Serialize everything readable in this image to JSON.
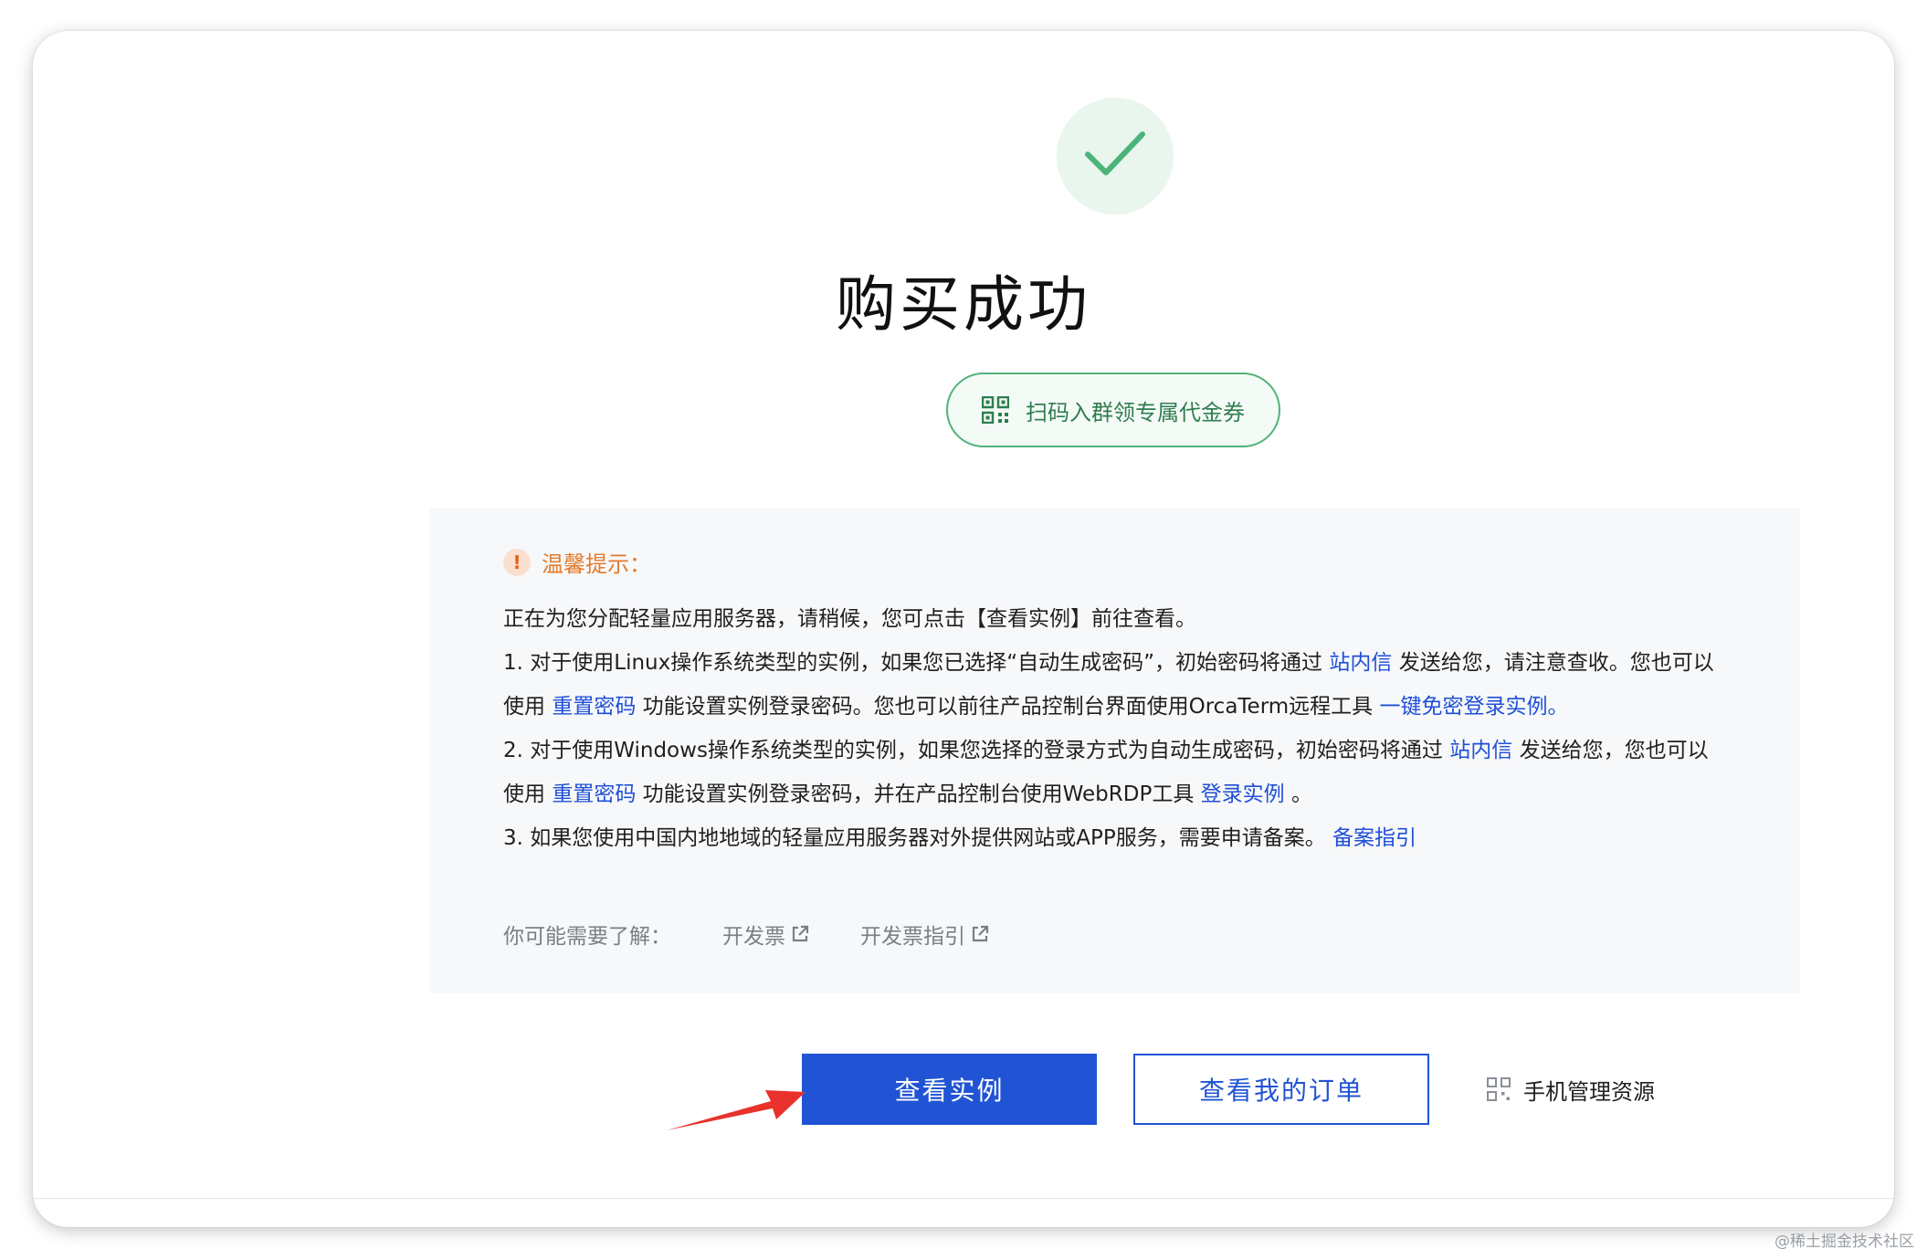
{
  "page": {
    "title": "购买成功",
    "coupon_button": "扫码入群领专属代金券"
  },
  "tips": {
    "heading": "温馨提示：",
    "intro": "正在为您分配轻量应用服务器，请稍候，您可点击【查看实例】前往查看。",
    "item1": {
      "text_a": "1. 对于使用Linux操作系统类型的实例，如果您已选择“自动生成密码”，初始密码将通过",
      "link_a": "站内信",
      "text_b": "发送给您，请注意查收。您也可以使用",
      "link_b": "重置密码",
      "text_c": "功能设置实例登录密码。您也可以前往产品控制台界面使用OrcaTerm远程工具",
      "link_c": "一键免密登录实例。"
    },
    "item2": {
      "text_a": "2. 对于使用Windows操作系统类型的实例，如果您选择的登录方式为自动生成密码，初始密码将通过",
      "link_a": "站内信",
      "text_b": "发送给您，您也可以使用",
      "link_b": "重置密码",
      "text_c": "功能设置实例登录密码，并在产品控制台使用WebRDP工具",
      "link_c": "登录实例",
      "text_d": "。"
    },
    "item3": {
      "text_a": "3. 如果您使用中国内地地域的轻量应用服务器对外提供网站或APP服务，需要申请备案。",
      "link_a": "备案指引"
    },
    "related": {
      "label": "你可能需要了解：",
      "links": [
        "开发票",
        "开发票指引"
      ]
    }
  },
  "actions": {
    "view_instance": "查看实例",
    "view_orders": "查看我的订单",
    "mobile_manage": "手机管理资源"
  },
  "icons": [
    "check-icon",
    "qr-code-icon",
    "warning-icon",
    "external-link-icon",
    "arrow-annotation"
  ],
  "colors": {
    "primary": "#2154d4",
    "success": "#4cb37a",
    "warning": "#e37b2c",
    "annotation_arrow": "#e8322b"
  },
  "watermark": "@稀土掘金技术社区"
}
